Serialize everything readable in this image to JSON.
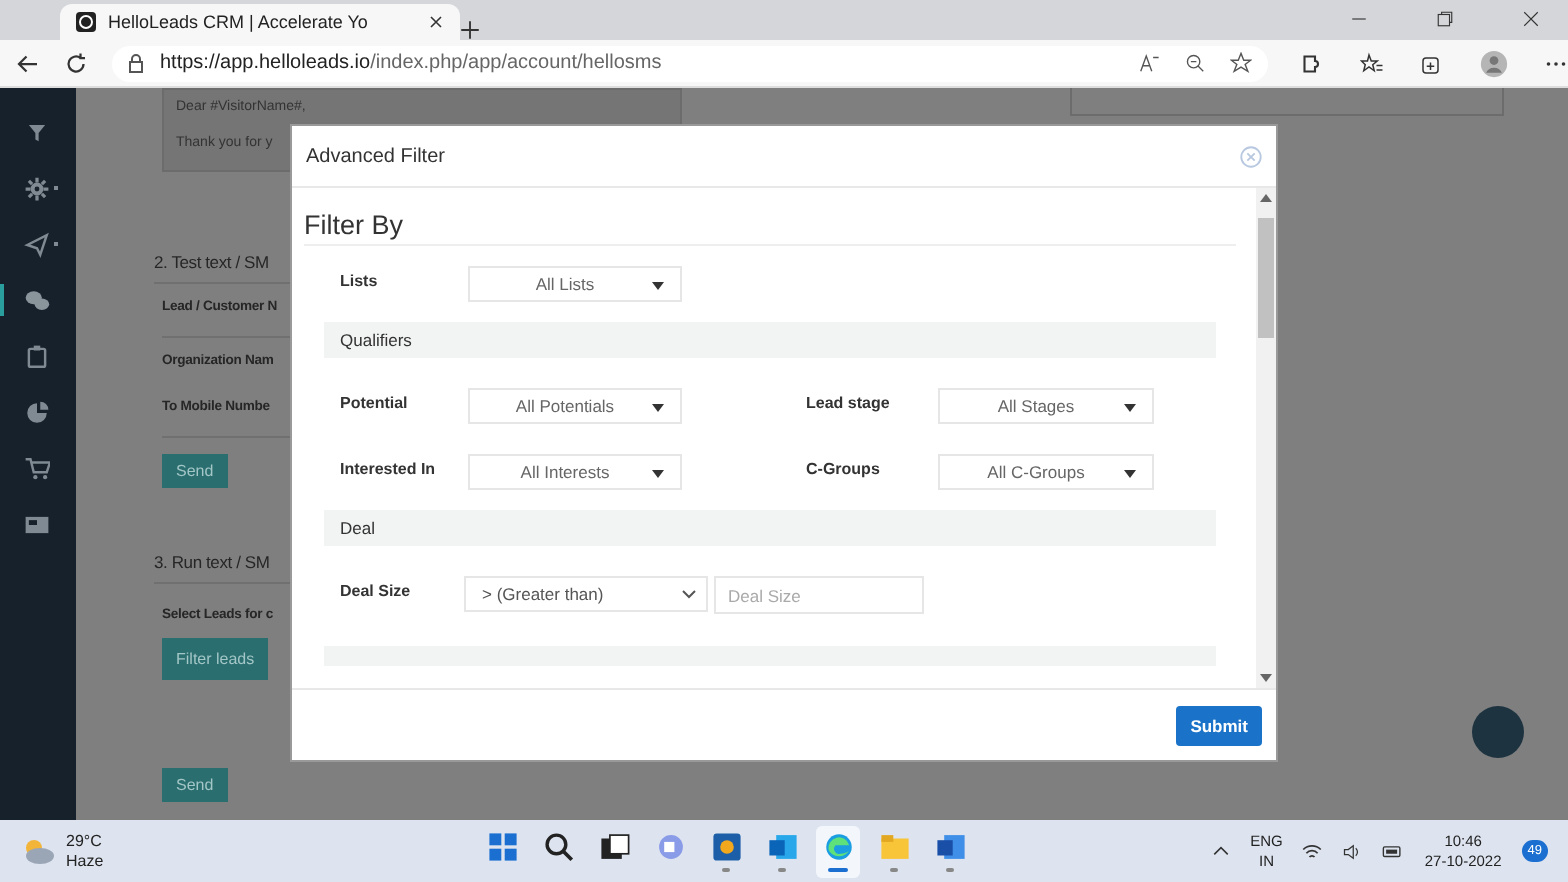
{
  "browser": {
    "tab_title": "HelloLeads CRM | Accelerate Yo",
    "url_host": "https://app.helloleads.io",
    "url_path": "/index.php/app/account/hellosms"
  },
  "sidebar": {
    "items": [
      {
        "selected": false
      },
      {
        "selected": false
      },
      {
        "selected": false
      },
      {
        "selected": true
      },
      {
        "selected": false
      },
      {
        "selected": false
      },
      {
        "selected": false
      },
      {
        "selected": false
      }
    ]
  },
  "page": {
    "message_lines": [
      "Dear #VisitorName#,",
      "Thank you for y"
    ],
    "test_section": {
      "title": "2. Test text / SM",
      "fields": [
        "Lead / Customer N",
        "Organization Nam",
        "To Mobile Numbe"
      ],
      "button": "Send"
    },
    "run_section": {
      "title": "3. Run text / SM",
      "label": "Select Leads for c",
      "filter_button": "Filter leads",
      "button": "Send"
    }
  },
  "modal": {
    "title": "Advanced Filter",
    "heading": "Filter By",
    "sections": [
      {
        "rows": [
          [
            {
              "kind": "dropdown",
              "label": "Lists",
              "value": "All Lists"
            }
          ]
        ]
      },
      {
        "title": "Qualifiers",
        "rows": [
          [
            {
              "kind": "dropdown",
              "label": "Potential",
              "value": "All Potentials"
            },
            {
              "kind": "dropdown",
              "label": "Lead stage",
              "value": "All Stages"
            }
          ],
          [
            {
              "kind": "dropdown",
              "label": "Interested In",
              "value": "All Interests"
            },
            {
              "kind": "dropdown",
              "label": "C-Groups",
              "value": "All C-Groups"
            }
          ]
        ]
      },
      {
        "title": "Deal",
        "rows": [
          [
            {
              "kind": "compare",
              "label": "Deal Size",
              "value": "> (Greater than)",
              "placeholder": "Deal Size"
            }
          ]
        ]
      }
    ],
    "submit": "Submit"
  },
  "taskbar": {
    "weather": {
      "temp": "29°C",
      "condition": "Haze"
    },
    "apps": [
      {
        "selected": false,
        "running": false
      },
      {
        "selected": false,
        "running": false
      },
      {
        "selected": false,
        "running": false
      },
      {
        "selected": false,
        "running": false
      },
      {
        "selected": false,
        "running": true
      },
      {
        "selected": false,
        "running": true
      },
      {
        "selected": true,
        "running": true
      },
      {
        "selected": false,
        "running": true
      },
      {
        "selected": false,
        "running": true
      }
    ],
    "language": [
      "ENG",
      "IN"
    ],
    "time": "10:46",
    "date": "27-10-2022",
    "notifications": "49"
  }
}
